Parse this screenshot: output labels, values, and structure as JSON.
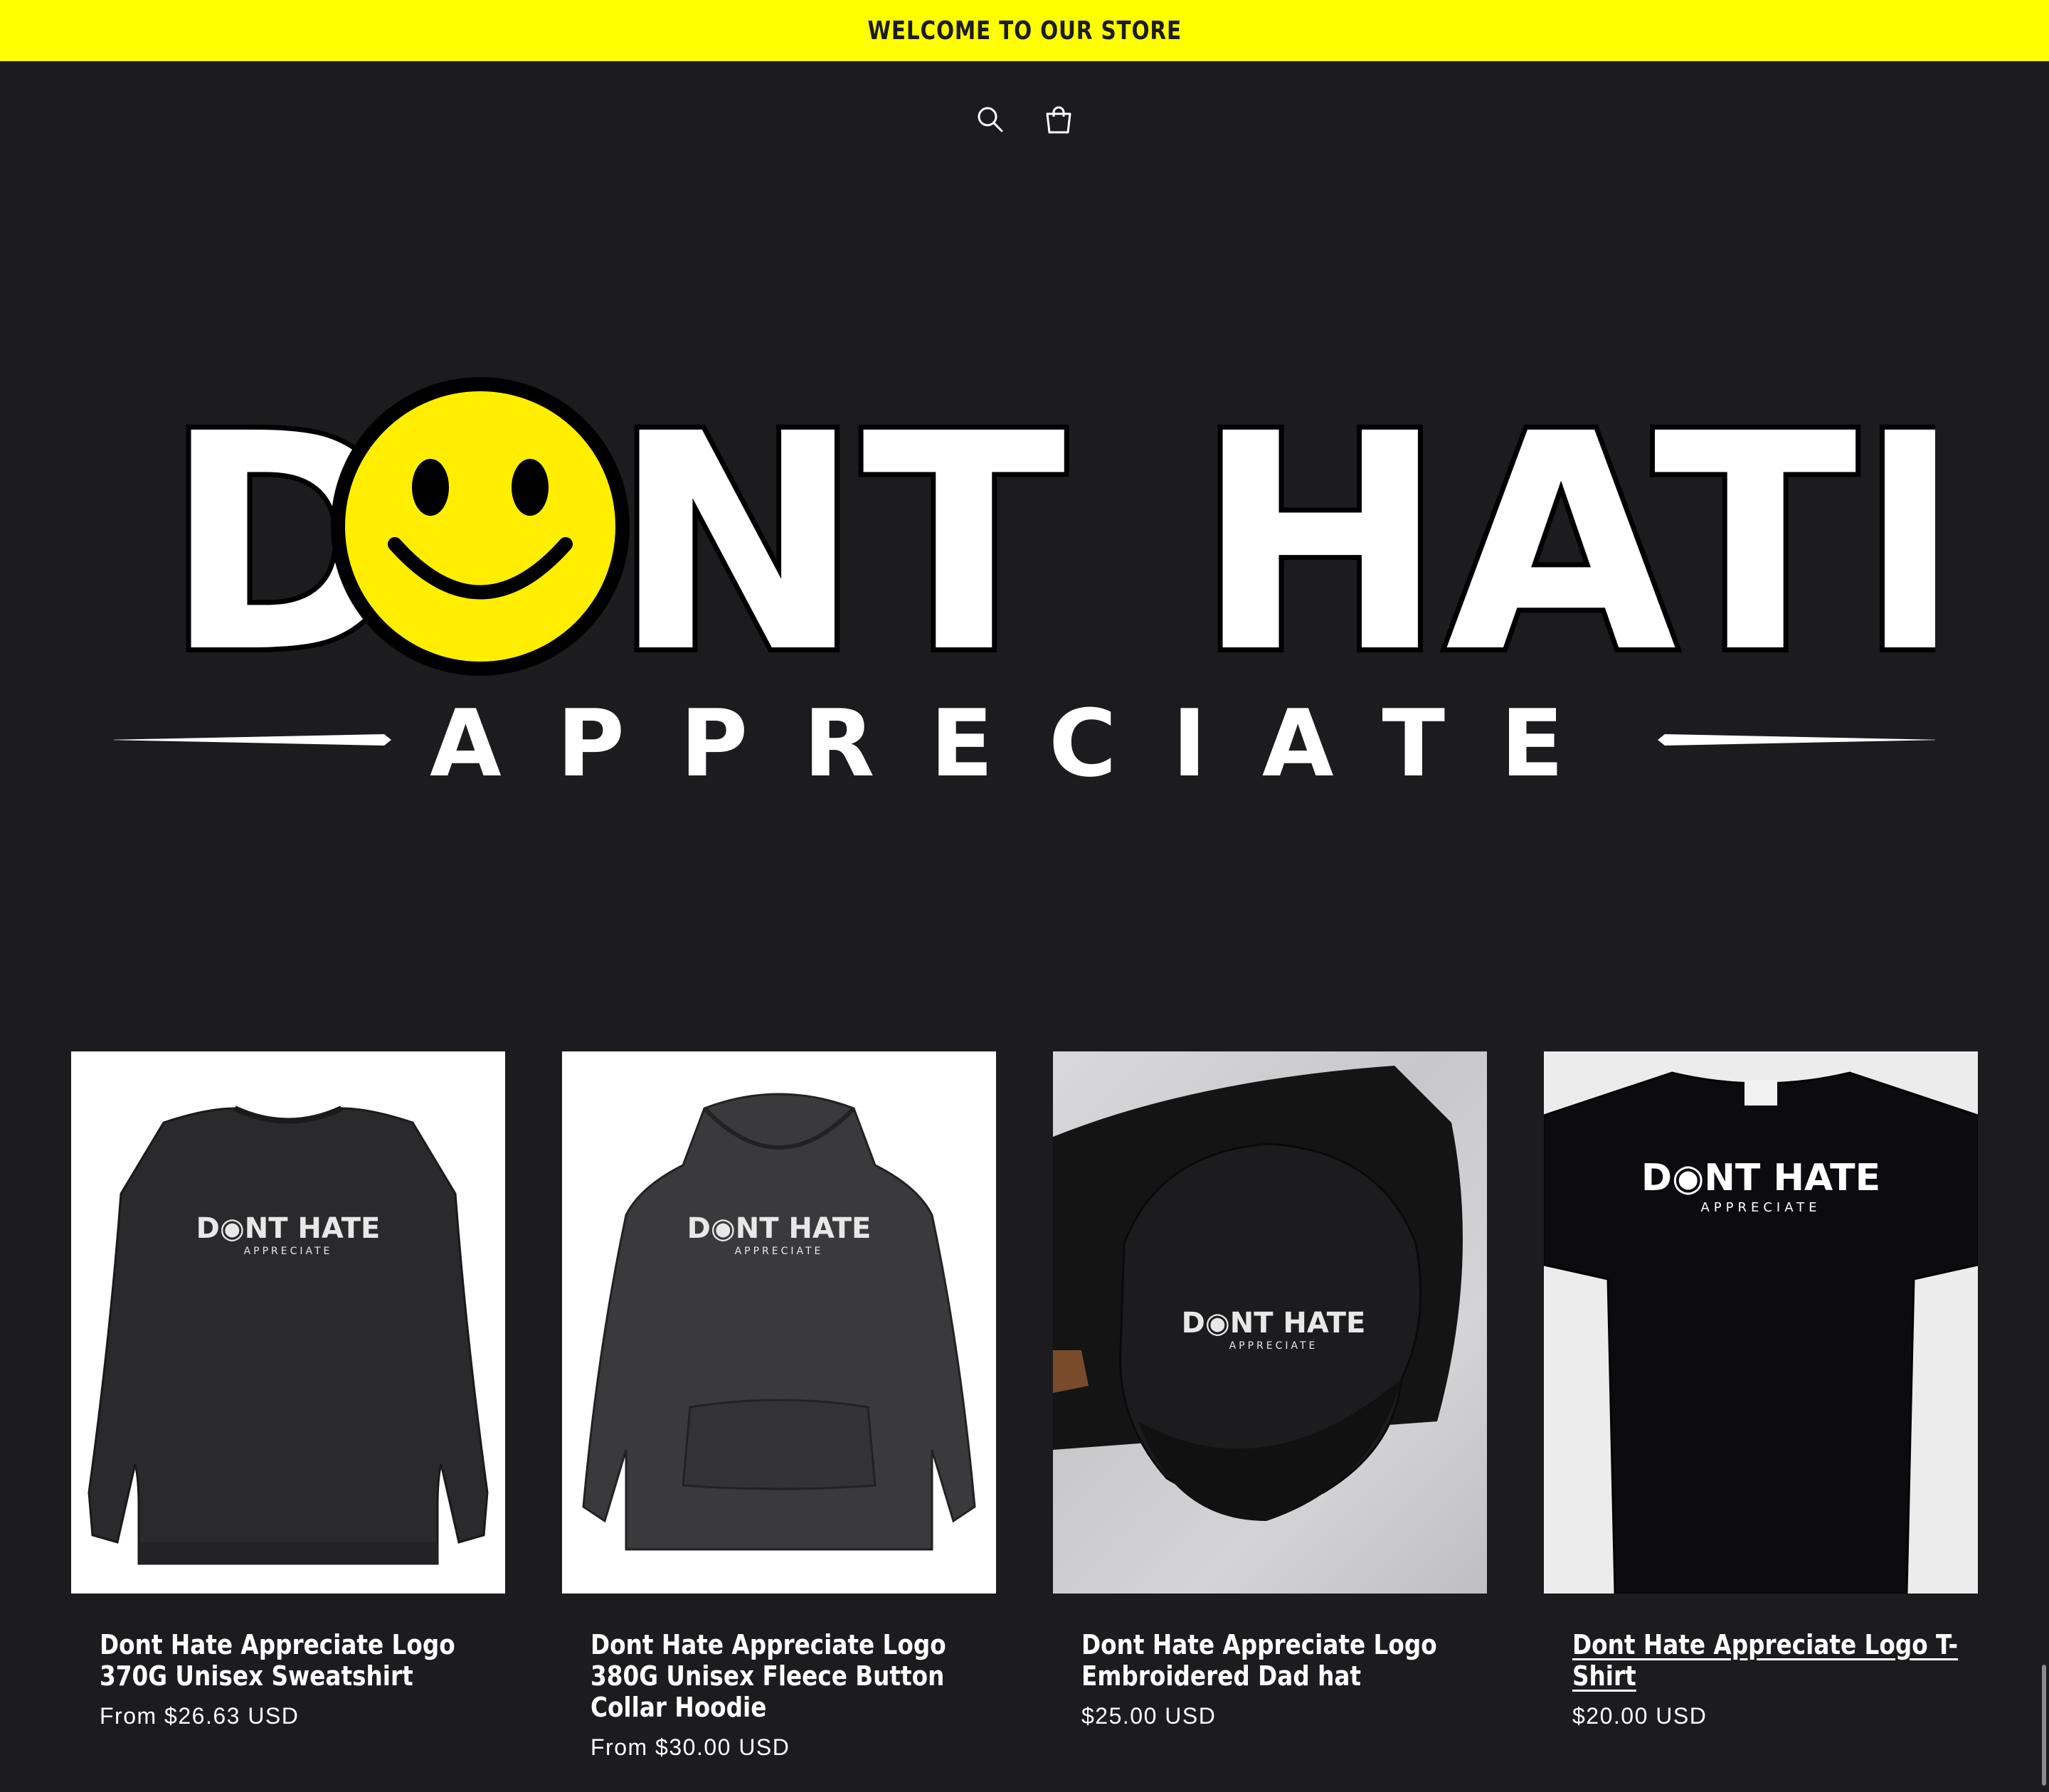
{
  "announcement": {
    "text": "WELCOME TO OUR STORE",
    "background": "#ffff00"
  },
  "header": {
    "icons": [
      "search-icon",
      "cart-icon"
    ]
  },
  "hero": {
    "logo_words": [
      "DONT",
      "HATE"
    ],
    "logo_tagline": "APPRECIATE",
    "smiley_color": "#ffee00"
  },
  "products": [
    {
      "title": "Dont Hate Appreciate Logo 370G Unisex Sweatshirt",
      "price": "From $26.63 USD"
    },
    {
      "title": "Dont Hate Appreciate Logo 380G Unisex Fleece Button Collar Hoodie",
      "price": "From $30.00 USD"
    },
    {
      "title": "Dont Hate Appreciate Logo Embroidered Dad hat",
      "price": "$25.00 USD"
    },
    {
      "title": "Dont Hate Appreciate Logo T-Shirt",
      "price": "$20.00 USD"
    }
  ],
  "colors": {
    "page_background": "#1c1c1e",
    "text": "#ffffff",
    "accent": "#ffff00"
  }
}
